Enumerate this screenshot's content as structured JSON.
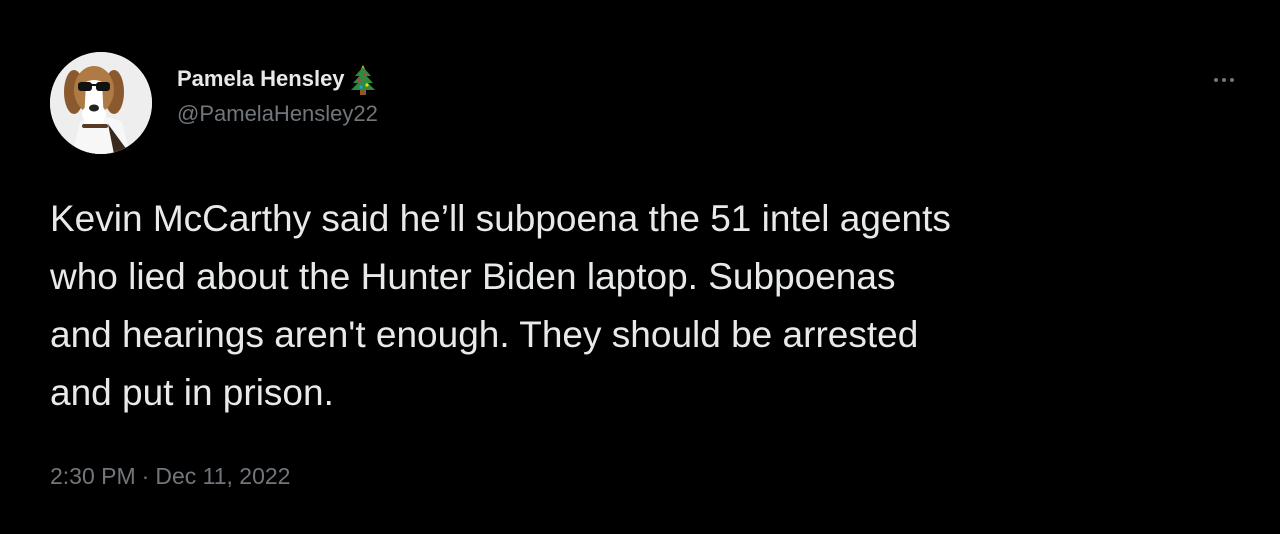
{
  "tweet": {
    "author": {
      "display_name": "Pamela Hensley",
      "name_emoji": "christmas-tree-icon",
      "handle": "@PamelaHensley22",
      "avatar": "beagle-dog-with-sunglasses"
    },
    "more_icon": "more-icon",
    "text": "Kevin McCarthy said he’ll subpoena the 51 intel agents\nwho lied about the Hunter Biden laptop. Subpoenas\nand hearings aren't enough. They should be arrested\nand put in prison.",
    "time": "2:30 PM",
    "separator": "·",
    "date": "Dec 11, 2022"
  },
  "colors": {
    "background": "#000000",
    "primary_text": "#e7e9ea",
    "secondary_text": "#71767b"
  }
}
